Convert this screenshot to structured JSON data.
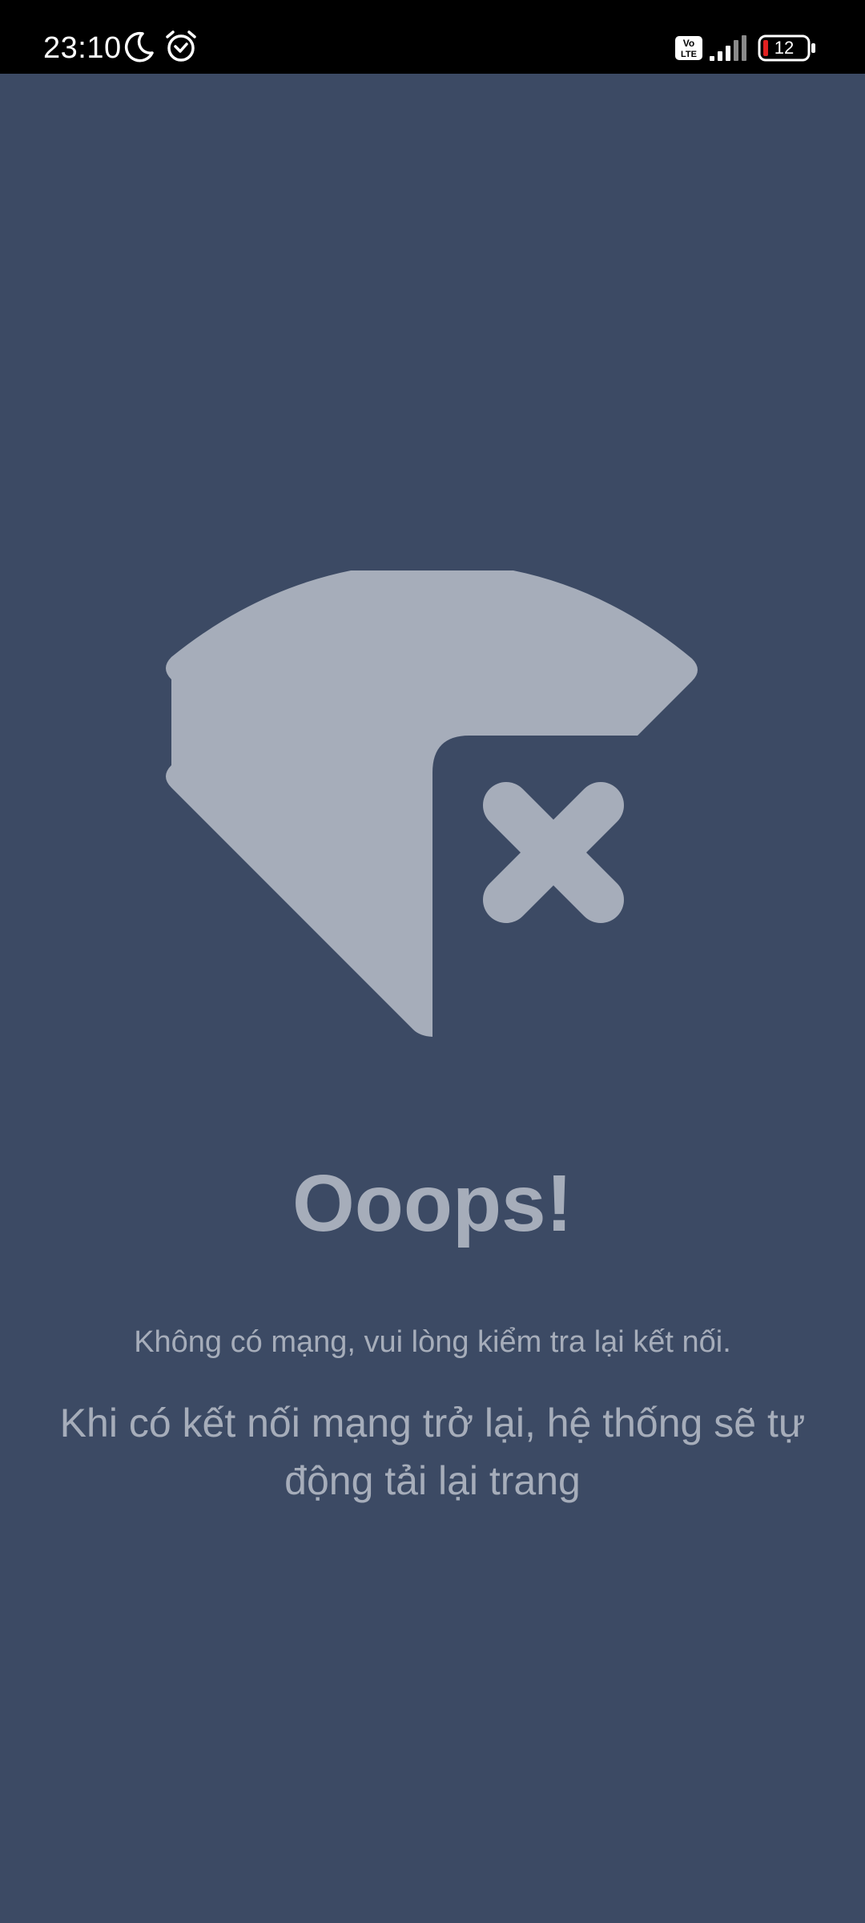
{
  "status_bar": {
    "time": "23:10",
    "battery_level": "12",
    "network_badge": "VoLTE",
    "icons": [
      "do-not-disturb-moon-icon",
      "alarm-icon",
      "volte-icon",
      "signal-icon",
      "battery-icon"
    ]
  },
  "error": {
    "icon": "wifi-off-icon",
    "title": "Ooops!",
    "message": "Không có mạng, vui lòng kiểm tra lại kết nối.",
    "detail": "Khi có kết nối mạng trở lại, hệ thống sẽ tự động tải lại trang"
  },
  "colors": {
    "background": "#3c4a64",
    "foreground": "#a6adba",
    "status_bar": "#000000",
    "battery_low": "#e02020"
  }
}
